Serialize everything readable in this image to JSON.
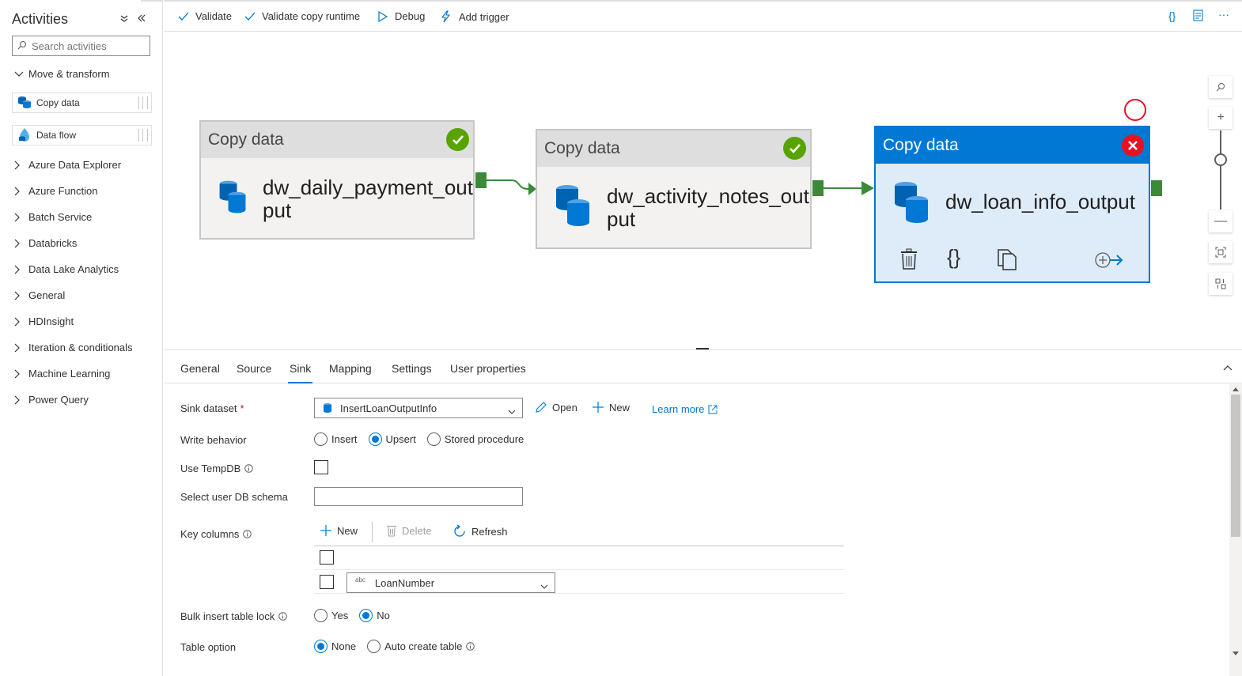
{
  "sidebar": {
    "title": "Activities",
    "search_placeholder": "Search activities",
    "move_transform": "Move & transform",
    "items": [
      {
        "label": "Copy data"
      },
      {
        "label": "Data flow"
      }
    ],
    "categories": [
      "Azure Data Explorer",
      "Azure Function",
      "Batch Service",
      "Databricks",
      "Data Lake Analytics",
      "General",
      "HDInsight",
      "Iteration & conditionals",
      "Machine Learning",
      "Power Query"
    ]
  },
  "toolbar": {
    "validate": "Validate",
    "validate_copy_runtime": "Validate copy runtime",
    "debug": "Debug",
    "add_trigger": "Add trigger"
  },
  "canvas": {
    "nodes": [
      {
        "type": "Copy data",
        "name_line1": "dw_daily_payment_out",
        "name_line2": "put",
        "status": "success"
      },
      {
        "type": "Copy data",
        "name_line1": "dw_activity_notes_out",
        "name_line2": "put",
        "status": "success"
      },
      {
        "type": "Copy data",
        "name_line1": "dw_loan_info_output",
        "name_line2": "",
        "status": "error",
        "selected": true
      }
    ]
  },
  "tabs": [
    "General",
    "Source",
    "Sink",
    "Mapping",
    "Settings",
    "User properties"
  ],
  "active_tab": "Sink",
  "sink": {
    "dataset_label": "Sink dataset",
    "dataset_required": "*",
    "dataset_value": "InsertLoanOutputInfo",
    "open": "Open",
    "new": "New",
    "learn_more": "Learn more",
    "write_behavior_label": "Write behavior",
    "write_options": [
      "Insert",
      "Upsert",
      "Stored procedure"
    ],
    "write_selected": "Upsert",
    "use_tempdb_label": "Use TempDB",
    "select_schema_label": "Select user DB schema",
    "key_columns_label": "Key columns",
    "kc_new": "New",
    "kc_delete": "Delete",
    "kc_refresh": "Refresh",
    "key_column_type": "abc",
    "key_column_value": "LoanNumber",
    "bulk_lock_label": "Bulk insert table lock",
    "bulk_options": [
      "Yes",
      "No"
    ],
    "bulk_selected": "No",
    "table_option_label": "Table option",
    "table_options": [
      "None",
      "Auto create table"
    ],
    "table_selected": "None"
  },
  "colors": {
    "accent": "#0078d4",
    "success": "#57a300",
    "error": "#e81123",
    "port": "#3a8a3a"
  }
}
